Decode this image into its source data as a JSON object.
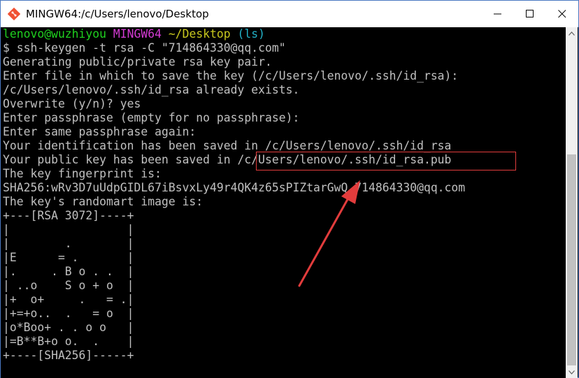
{
  "window": {
    "title": "MINGW64:/c/Users/lenovo/Desktop",
    "icon": "git-bash-icon",
    "controls": [
      "minimize-icon",
      "maximize-icon",
      "close-icon"
    ]
  },
  "terminal": {
    "prompt": {
      "user_host": "lenovo@wuzhiyou",
      "system": "MINGW64",
      "cwd": "~/Desktop",
      "branch": "(ls)"
    },
    "lines": [
      "$ ssh-keygen -t rsa -C \"714864330@qq.com\"",
      "Generating public/private rsa key pair.",
      "Enter file in which to save the key (/c/Users/lenovo/.ssh/id_rsa):",
      "/c/Users/lenovo/.ssh/id_rsa already exists.",
      "Overwrite (y/n)? yes",
      "Enter passphrase (empty for no passphrase):",
      "Enter same passphrase again:",
      "Your identification has been saved in /c/Users/lenovo/.ssh/id_rsa",
      "Your public key has been saved in /c/Users/lenovo/.ssh/id_rsa.pub",
      "The key fingerprint is:",
      "SHA256:wRv3D7uUdpGIDL67iBsvxLy49r4QK4z65sPIZtarGwQ 714864330@qq.com",
      "The key's randomart image is:",
      "+---[RSA 3072]----+",
      "|                 |",
      "|        .        |",
      "|E      = .       |",
      "|.     . B o . .  |",
      "| ..o    S o + o  |",
      "|+  o+     .   = .|",
      "|+=+o..  .   = o  |",
      "|o*Boo+ . . o o   |",
      "|=B**B+o o.  .    |",
      "+----[SHA256]-----+"
    ]
  },
  "annotation": {
    "highlight_color": "#e23c3c"
  }
}
